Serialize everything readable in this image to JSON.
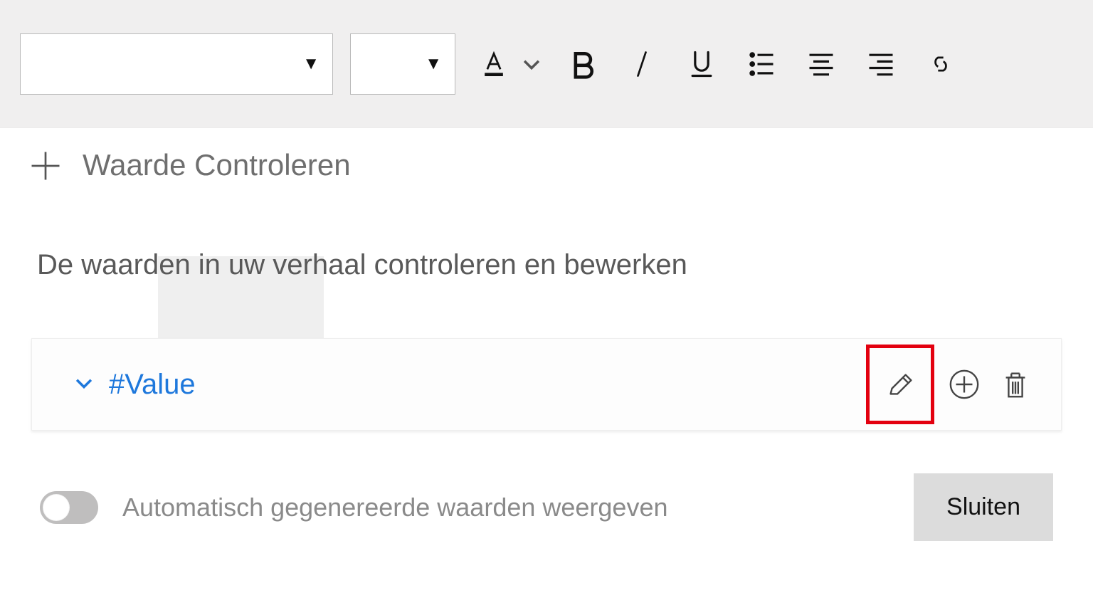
{
  "toolbar": {
    "font_value": "",
    "size_value": ""
  },
  "tab": {
    "label": "Waarde Controleren"
  },
  "subtitle": "De waarden in uw verhaal controleren en bewerken",
  "card": {
    "value": "#Value"
  },
  "footer": {
    "toggle_label": "Automatisch gegenereerde waarden weergeven",
    "toggle_on": false,
    "close_label": "Sluiten"
  }
}
